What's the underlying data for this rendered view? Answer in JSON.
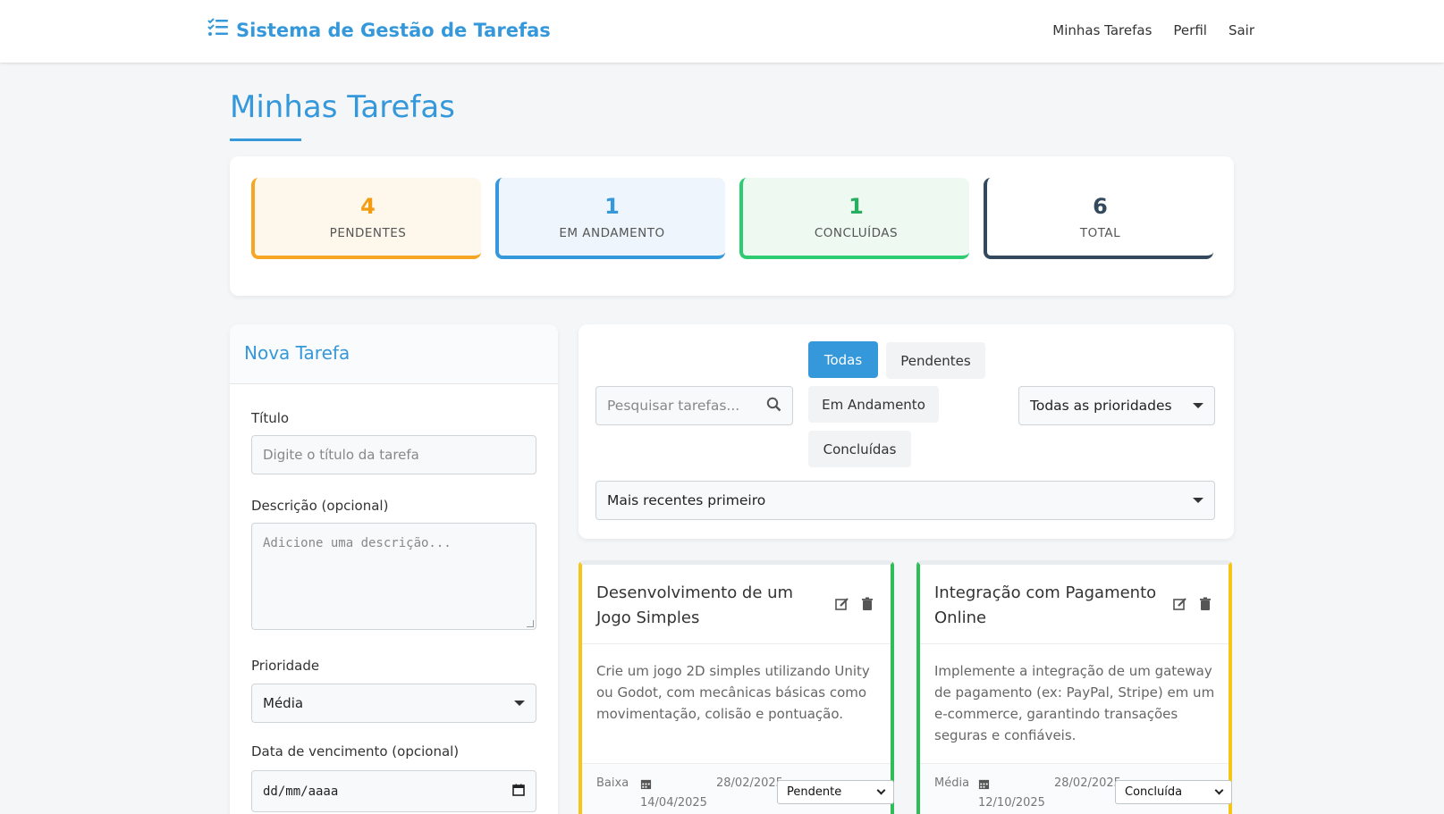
{
  "nav": {
    "brand": "Sistema de Gestão de Tarefas",
    "brand_icon": "task-list-icon",
    "links": [
      "Minhas Tarefas",
      "Perfil",
      "Sair"
    ]
  },
  "page": {
    "title": "Minhas Tarefas"
  },
  "stats": [
    {
      "value": "4",
      "label": "PENDENTES",
      "color": "#f39c12"
    },
    {
      "value": "1",
      "label": "EM ANDAMENTO",
      "color": "#3498db"
    },
    {
      "value": "1",
      "label": "CONCLUÍDAS",
      "color": "#27ae60"
    },
    {
      "value": "6",
      "label": "TOTAL",
      "color": "#34495e"
    }
  ],
  "form": {
    "header": "Nova Tarefa",
    "title_label": "Título",
    "title_placeholder": "Digite o título da tarefa",
    "description_label": "Descrição (opcional)",
    "description_placeholder": "Adicione uma descrição...",
    "priority_label": "Prioridade",
    "priority_value": "Média",
    "due_label": "Data de vencimento (opcional)",
    "due_placeholder": "dd/mm/aaaa"
  },
  "filters": {
    "search_placeholder": "Pesquisar tarefas...",
    "status_buttons": [
      "Todas",
      "Pendentes",
      "Em Andamento",
      "Concluídas"
    ],
    "active_status": "Todas",
    "priority_value": "Todas as prioridades",
    "sort_value": "Mais recentes primeiro"
  },
  "tasks": [
    {
      "title": "Desenvolvimento de um Jogo Simples",
      "description": "Crie um jogo 2D simples utilizando Unity ou Godot, com mecânicas básicas como movimentação, colisão e pontuação.",
      "priority": "Baixa",
      "created": "28/02/2025",
      "due": "14/04/2025",
      "status": "Pendente"
    },
    {
      "title": "Integração com Pagamento Online",
      "description": "Implemente a integração de um gateway de pagamento (ex: PayPal, Stripe) em um e-commerce, garantindo transações seguras e confiáveis.",
      "priority": "Média",
      "created": "28/02/2025",
      "due": "12/10/2025",
      "status": "Concluída"
    }
  ]
}
